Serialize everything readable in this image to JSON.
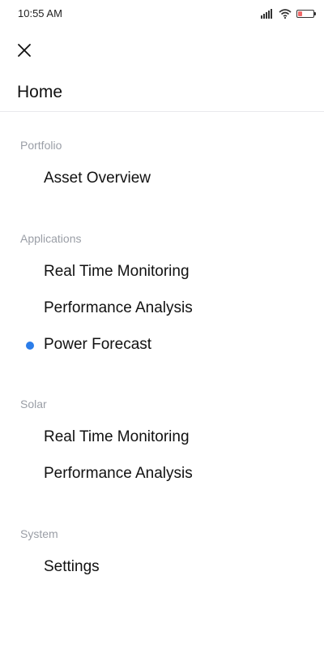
{
  "status_bar": {
    "time": "10:55 AM",
    "icons": [
      "signal-icon",
      "wifi-icon",
      "battery-icon"
    ],
    "battery_level": 0.25,
    "battery_color": "#f06a6a"
  },
  "header": {
    "close_icon": "close-icon",
    "home_label": "Home"
  },
  "colors": {
    "active_indicator": "#2b7de9",
    "section_title": "#9a9ea6"
  },
  "menu": {
    "sections": [
      {
        "title": "Portfolio",
        "items": [
          {
            "label": "Asset Overview",
            "active": false
          }
        ]
      },
      {
        "title": "Applications",
        "items": [
          {
            "label": "Real Time Monitoring",
            "active": false
          },
          {
            "label": "Performance Analysis",
            "active": false
          },
          {
            "label": "Power Forecast",
            "active": true
          }
        ]
      },
      {
        "title": "Solar",
        "items": [
          {
            "label": "Real Time Monitoring",
            "active": false
          },
          {
            "label": "Performance Analysis",
            "active": false
          }
        ]
      },
      {
        "title": "System",
        "items": [
          {
            "label": "Settings",
            "active": false
          }
        ]
      }
    ]
  }
}
